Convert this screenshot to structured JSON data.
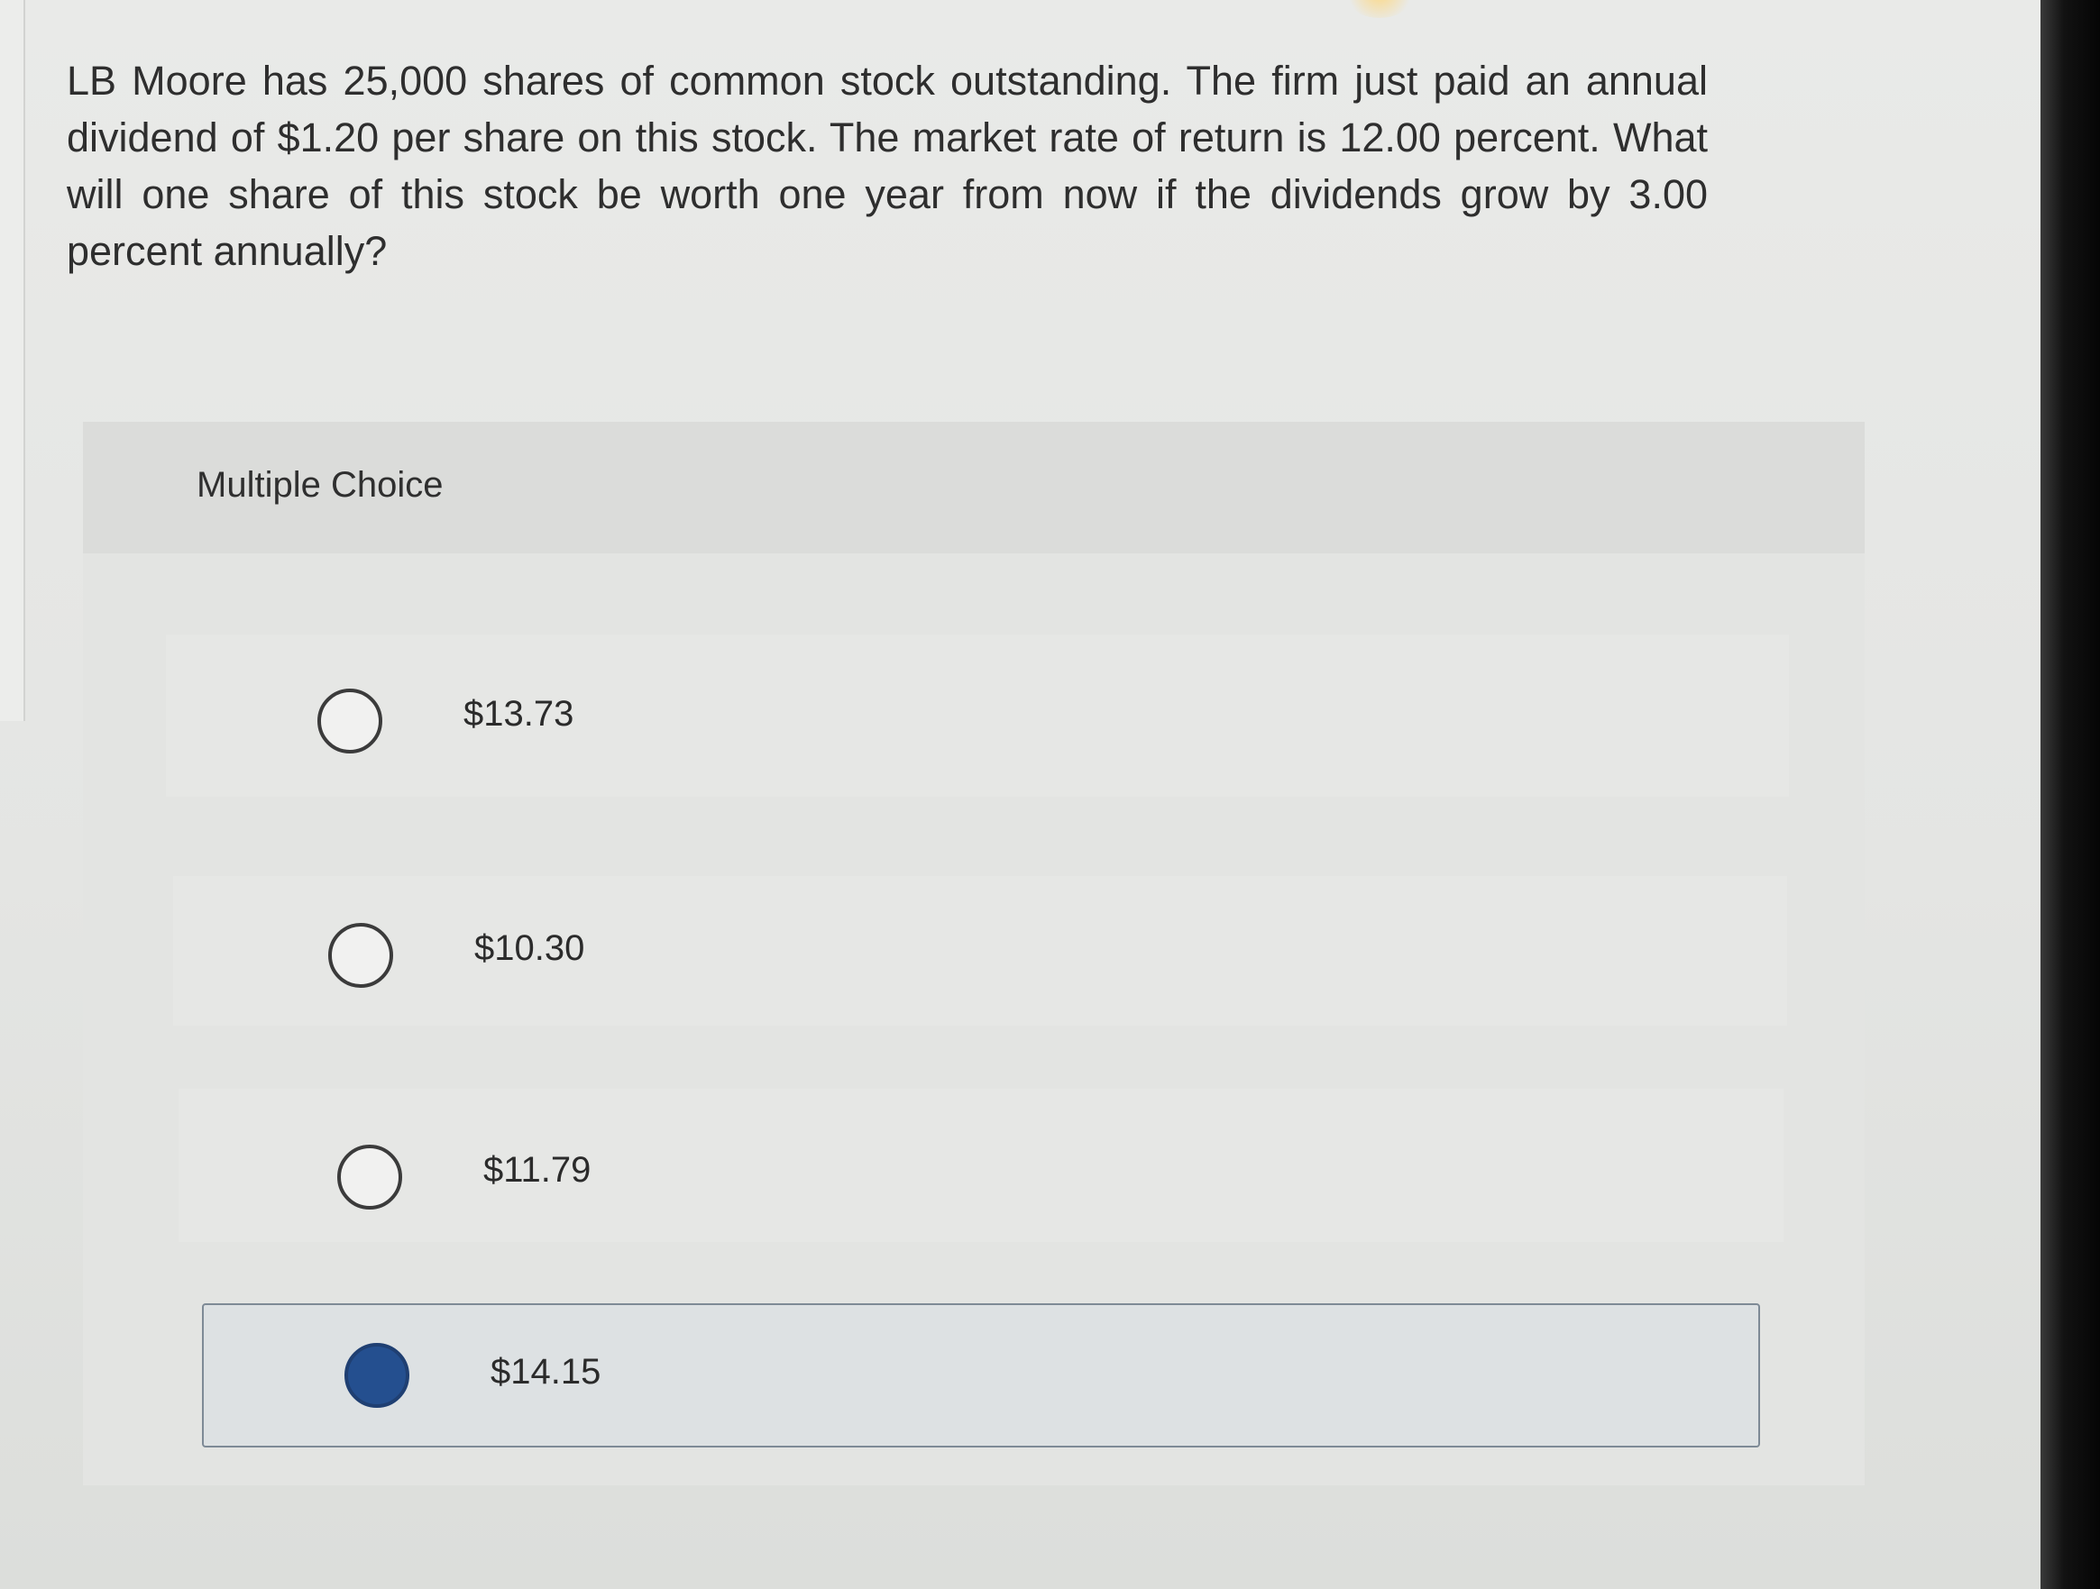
{
  "question": {
    "text": "LB Moore has 25,000 shares of common stock outstanding. The firm just paid an annual dividend of $1.20 per share on this stock. The market rate of return is 12.00 percent. What will one share of this stock be worth one year from now if the dividends grow by 3.00 percent annually?"
  },
  "multiple_choice": {
    "title": "Multiple Choice",
    "options": [
      {
        "label": "$13.73",
        "selected": false
      },
      {
        "label": "$10.30",
        "selected": false
      },
      {
        "label": "$11.79",
        "selected": false
      },
      {
        "label": "$14.15",
        "selected": true
      }
    ]
  },
  "colors": {
    "selected_radio": "#244f8f",
    "selected_border": "#7e8a96"
  }
}
